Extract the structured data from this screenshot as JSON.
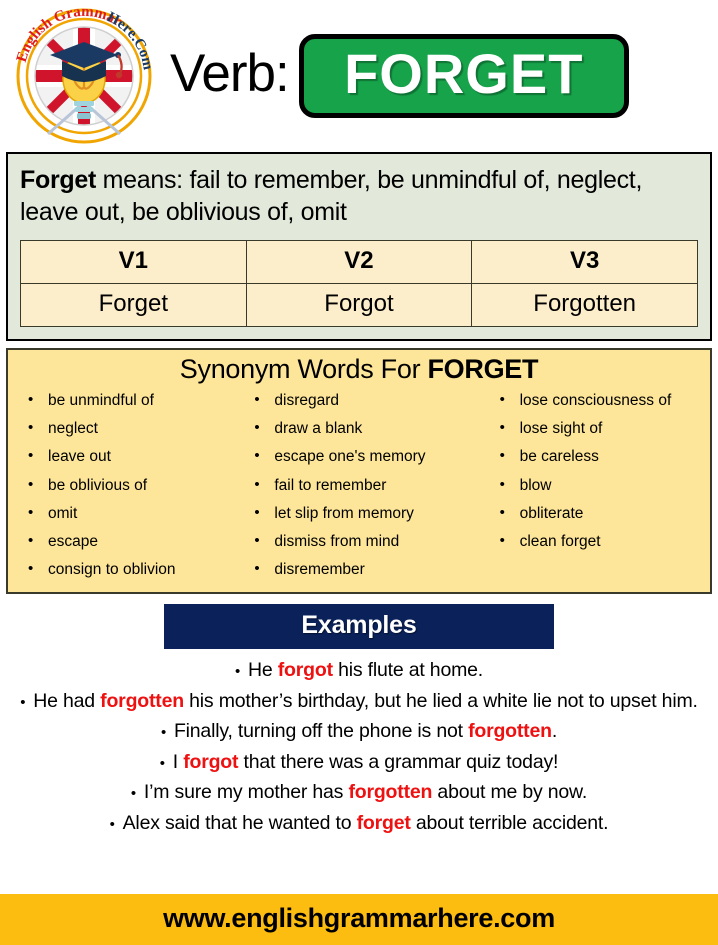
{
  "header": {
    "logo": {
      "arc_text_1": "English Grammar",
      "arc_text_2": "Here.Com",
      "icon_names": [
        "uk-flag",
        "graduation-cap",
        "lightbulb-brain"
      ]
    },
    "verb_label": "Verb:",
    "verb_word": "FORGET",
    "banner_color": "#16a34a"
  },
  "definition": {
    "word": "Forget",
    "lead": " means: ",
    "meaning": "fail to remember, be unmindful of, neglect, leave out, be oblivious of, omit",
    "background_color": "#e2e9da"
  },
  "forms_table": {
    "headers": [
      "V1",
      "V2",
      "V3"
    ],
    "row": [
      "Forget",
      "Forgot",
      "Forgotten"
    ],
    "cell_color": "#fdeecb"
  },
  "synonyms": {
    "title_prefix": "Synonym Words For ",
    "title_word": "FORGET",
    "background_color": "#fde599",
    "columns": [
      [
        "be unmindful of",
        "neglect",
        "leave out",
        "be oblivious of",
        "omit",
        "escape",
        "consign to oblivion"
      ],
      [
        "disregard",
        "draw a blank",
        "escape one's memory",
        "fail to remember",
        "let slip from memory",
        "dismiss from mind",
        "disremember"
      ],
      [
        "lose consciousness  of",
        "lose sight of",
        "be careless",
        "blow",
        "obliterate",
        "clean forget"
      ]
    ]
  },
  "examples": {
    "banner_label": "Examples",
    "banner_color": "#0a2159",
    "highlight_color": "#ee1111",
    "items": [
      [
        {
          "t": "He ",
          "s": "n"
        },
        {
          "t": "forgot",
          "s": "h"
        },
        {
          "t": " his flute at home.",
          "s": "n"
        }
      ],
      [
        {
          "t": "He had ",
          "s": "n"
        },
        {
          "t": "forgotten",
          "s": "h"
        },
        {
          "t": " his mother’s birthday, but he lied a white lie not to upset him.",
          "s": "n"
        }
      ],
      [
        {
          "t": "Finally, turning off the phone is not ",
          "s": "n"
        },
        {
          "t": "forgotten",
          "s": "h"
        },
        {
          "t": ".",
          "s": "n"
        }
      ],
      [
        {
          "t": "I ",
          "s": "n"
        },
        {
          "t": "forgot",
          "s": "h"
        },
        {
          "t": " that there was a grammar quiz today!",
          "s": "n"
        }
      ],
      [
        {
          "t": "I’m sure my mother has ",
          "s": "n"
        },
        {
          "t": "forgotten",
          "s": "h"
        },
        {
          "t": " about me by now.",
          "s": "n"
        }
      ],
      [
        {
          "t": "Alex said that he wanted to ",
          "s": "n"
        },
        {
          "t": "forget",
          "s": "h"
        },
        {
          "t": " about terrible accident.",
          "s": "n"
        }
      ]
    ]
  },
  "footer": {
    "url": "www.englishgrammarhere.com",
    "background_color": "#fdbd10"
  }
}
